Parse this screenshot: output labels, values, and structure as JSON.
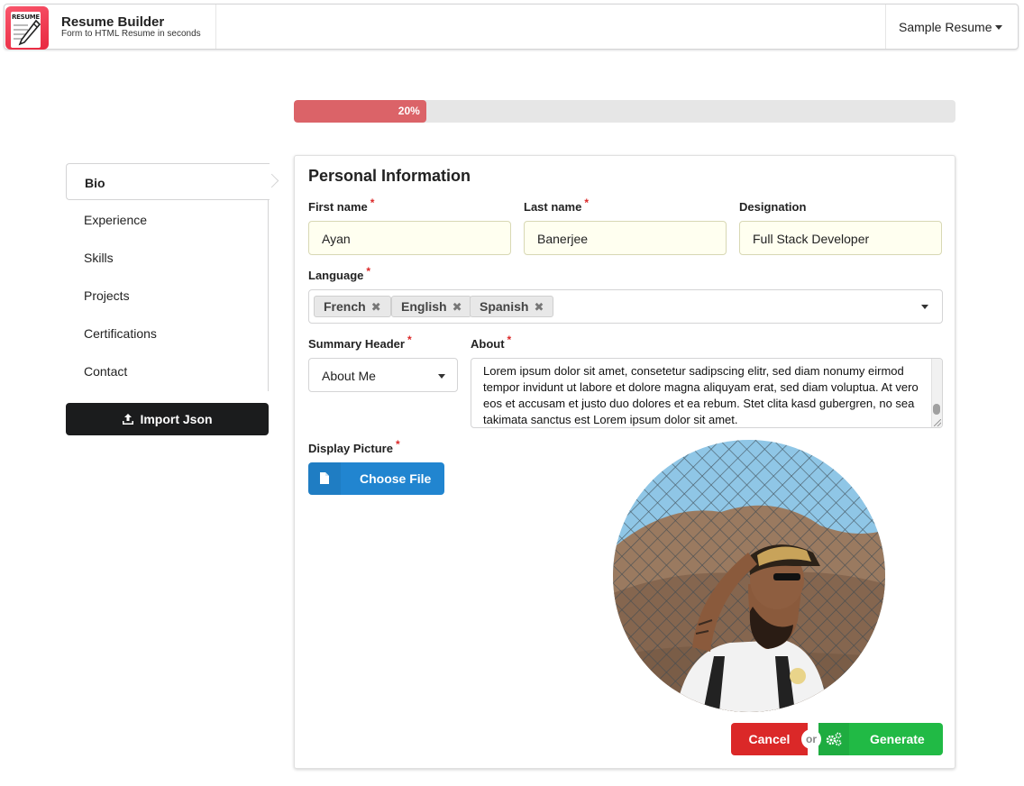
{
  "app": {
    "title": "Resume Builder",
    "subtitle": "Form to HTML Resume in seconds",
    "logo_text": "RESUME",
    "sample_dropdown": "Sample Resume"
  },
  "progress": {
    "value": 20,
    "label": "20%"
  },
  "steps": [
    {
      "label": "Bio",
      "active": true
    },
    {
      "label": "Experience",
      "active": false
    },
    {
      "label": "Skills",
      "active": false
    },
    {
      "label": "Projects",
      "active": false
    },
    {
      "label": "Certifications",
      "active": false
    },
    {
      "label": "Contact",
      "active": false
    }
  ],
  "import_button": "Import Json",
  "form": {
    "title": "Personal Information",
    "first_name": {
      "label": "First name",
      "value": "Ayan",
      "required": "*"
    },
    "last_name": {
      "label": "Last name",
      "value": "Banerjee",
      "required": "*"
    },
    "designation": {
      "label": "Designation",
      "value": "Full Stack Developer"
    },
    "language": {
      "label": "Language",
      "required": "*",
      "values": [
        "French",
        "English",
        "Spanish"
      ],
      "remove_glyph": "✖"
    },
    "summary_header": {
      "label": "Summary Header",
      "required": "*",
      "value": "About Me"
    },
    "about": {
      "label": "About",
      "required": "*",
      "value": "Lorem ipsum dolor sit amet, consetetur sadipscing elitr, sed diam nonumy eirmod tempor invidunt ut labore et dolore magna aliquyam erat, sed diam voluptua. At vero eos et accusam et justo duo dolores et ea rebum. Stet clita kasd gubergren, no sea takimata sanctus est Lorem ipsum dolor sit amet."
    },
    "display_picture": {
      "label": "Display Picture",
      "required": "*",
      "button": "Choose File"
    }
  },
  "actions": {
    "cancel": "Cancel",
    "or": "or",
    "generate": "Generate"
  },
  "colors": {
    "progress": "#db6368",
    "import": "#1b1c1d",
    "choose_file": "#2185d0",
    "cancel": "#db2828",
    "generate": "#21ba45",
    "input_bg": "#fffff0"
  },
  "icons": {
    "import": "upload-icon",
    "choose_file": "file-icon",
    "generate": "cogs-icon",
    "dropdown": "caret-down-icon"
  }
}
